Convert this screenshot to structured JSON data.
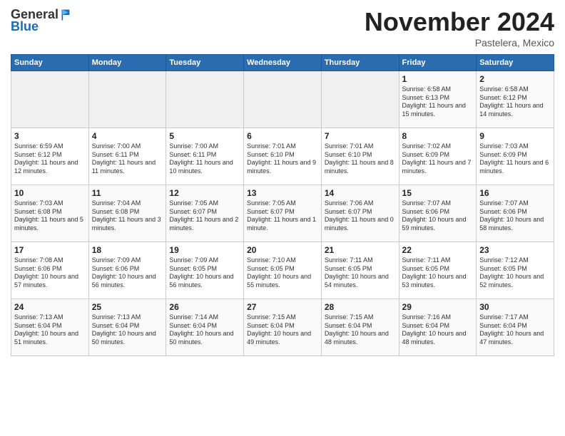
{
  "header": {
    "logo_line1": "General",
    "logo_line2": "Blue",
    "month": "November 2024",
    "location": "Pastelera, Mexico"
  },
  "weekdays": [
    "Sunday",
    "Monday",
    "Tuesday",
    "Wednesday",
    "Thursday",
    "Friday",
    "Saturday"
  ],
  "weeks": [
    [
      {
        "day": "",
        "info": ""
      },
      {
        "day": "",
        "info": ""
      },
      {
        "day": "",
        "info": ""
      },
      {
        "day": "",
        "info": ""
      },
      {
        "day": "",
        "info": ""
      },
      {
        "day": "1",
        "info": "Sunrise: 6:58 AM\nSunset: 6:13 PM\nDaylight: 11 hours and 15 minutes."
      },
      {
        "day": "2",
        "info": "Sunrise: 6:58 AM\nSunset: 6:12 PM\nDaylight: 11 hours and 14 minutes."
      }
    ],
    [
      {
        "day": "3",
        "info": "Sunrise: 6:59 AM\nSunset: 6:12 PM\nDaylight: 11 hours and 12 minutes."
      },
      {
        "day": "4",
        "info": "Sunrise: 7:00 AM\nSunset: 6:11 PM\nDaylight: 11 hours and 11 minutes."
      },
      {
        "day": "5",
        "info": "Sunrise: 7:00 AM\nSunset: 6:11 PM\nDaylight: 11 hours and 10 minutes."
      },
      {
        "day": "6",
        "info": "Sunrise: 7:01 AM\nSunset: 6:10 PM\nDaylight: 11 hours and 9 minutes."
      },
      {
        "day": "7",
        "info": "Sunrise: 7:01 AM\nSunset: 6:10 PM\nDaylight: 11 hours and 8 minutes."
      },
      {
        "day": "8",
        "info": "Sunrise: 7:02 AM\nSunset: 6:09 PM\nDaylight: 11 hours and 7 minutes."
      },
      {
        "day": "9",
        "info": "Sunrise: 7:03 AM\nSunset: 6:09 PM\nDaylight: 11 hours and 6 minutes."
      }
    ],
    [
      {
        "day": "10",
        "info": "Sunrise: 7:03 AM\nSunset: 6:08 PM\nDaylight: 11 hours and 5 minutes."
      },
      {
        "day": "11",
        "info": "Sunrise: 7:04 AM\nSunset: 6:08 PM\nDaylight: 11 hours and 3 minutes."
      },
      {
        "day": "12",
        "info": "Sunrise: 7:05 AM\nSunset: 6:07 PM\nDaylight: 11 hours and 2 minutes."
      },
      {
        "day": "13",
        "info": "Sunrise: 7:05 AM\nSunset: 6:07 PM\nDaylight: 11 hours and 1 minute."
      },
      {
        "day": "14",
        "info": "Sunrise: 7:06 AM\nSunset: 6:07 PM\nDaylight: 11 hours and 0 minutes."
      },
      {
        "day": "15",
        "info": "Sunrise: 7:07 AM\nSunset: 6:06 PM\nDaylight: 10 hours and 59 minutes."
      },
      {
        "day": "16",
        "info": "Sunrise: 7:07 AM\nSunset: 6:06 PM\nDaylight: 10 hours and 58 minutes."
      }
    ],
    [
      {
        "day": "17",
        "info": "Sunrise: 7:08 AM\nSunset: 6:06 PM\nDaylight: 10 hours and 57 minutes."
      },
      {
        "day": "18",
        "info": "Sunrise: 7:09 AM\nSunset: 6:06 PM\nDaylight: 10 hours and 56 minutes."
      },
      {
        "day": "19",
        "info": "Sunrise: 7:09 AM\nSunset: 6:05 PM\nDaylight: 10 hours and 56 minutes."
      },
      {
        "day": "20",
        "info": "Sunrise: 7:10 AM\nSunset: 6:05 PM\nDaylight: 10 hours and 55 minutes."
      },
      {
        "day": "21",
        "info": "Sunrise: 7:11 AM\nSunset: 6:05 PM\nDaylight: 10 hours and 54 minutes."
      },
      {
        "day": "22",
        "info": "Sunrise: 7:11 AM\nSunset: 6:05 PM\nDaylight: 10 hours and 53 minutes."
      },
      {
        "day": "23",
        "info": "Sunrise: 7:12 AM\nSunset: 6:05 PM\nDaylight: 10 hours and 52 minutes."
      }
    ],
    [
      {
        "day": "24",
        "info": "Sunrise: 7:13 AM\nSunset: 6:04 PM\nDaylight: 10 hours and 51 minutes."
      },
      {
        "day": "25",
        "info": "Sunrise: 7:13 AM\nSunset: 6:04 PM\nDaylight: 10 hours and 50 minutes."
      },
      {
        "day": "26",
        "info": "Sunrise: 7:14 AM\nSunset: 6:04 PM\nDaylight: 10 hours and 50 minutes."
      },
      {
        "day": "27",
        "info": "Sunrise: 7:15 AM\nSunset: 6:04 PM\nDaylight: 10 hours and 49 minutes."
      },
      {
        "day": "28",
        "info": "Sunrise: 7:15 AM\nSunset: 6:04 PM\nDaylight: 10 hours and 48 minutes."
      },
      {
        "day": "29",
        "info": "Sunrise: 7:16 AM\nSunset: 6:04 PM\nDaylight: 10 hours and 48 minutes."
      },
      {
        "day": "30",
        "info": "Sunrise: 7:17 AM\nSunset: 6:04 PM\nDaylight: 10 hours and 47 minutes."
      }
    ]
  ]
}
